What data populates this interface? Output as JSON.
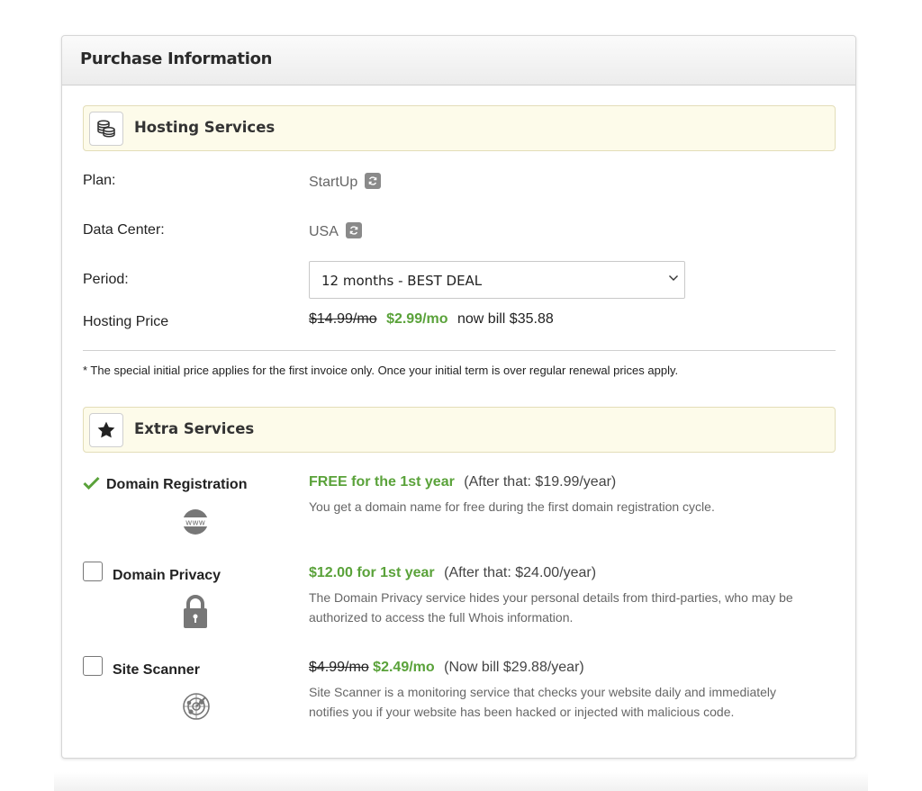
{
  "panel": {
    "title": "Purchase Information"
  },
  "hosting": {
    "section_title": "Hosting Services",
    "section_icon": "coins-icon",
    "plan_label": "Plan:",
    "plan_value": "StartUp",
    "datacenter_label": "Data Center:",
    "datacenter_value": "USA",
    "period_label": "Period:",
    "period_selected": "12 months - BEST DEAL",
    "price_label": "Hosting Price",
    "price_old": "$14.99/mo",
    "price_new": "$2.99/mo",
    "price_bill": "now bill $35.88",
    "note": "* The special initial price applies for the first invoice only. Once your initial term is over regular renewal prices apply."
  },
  "extras": {
    "section_title": "Extra Services",
    "section_icon": "star-icon",
    "items": [
      {
        "name": "Domain Registration",
        "selected": true,
        "icon": "www-globe-icon",
        "price_highlight": "FREE for the 1st year",
        "price_after": "(After that: $19.99/year)",
        "description": "You get a domain name for free during the first domain registration cycle."
      },
      {
        "name": "Domain Privacy",
        "selected": false,
        "icon": "lock-icon",
        "price_highlight": "$12.00 for 1st year",
        "price_after": "(After that: $24.00/year)",
        "description": "The Domain Privacy service hides your personal details from third-parties, who may be authorized to access the full Whois information."
      },
      {
        "name": "Site Scanner",
        "selected": false,
        "icon": "radar-icon",
        "price_old": "$4.99/mo",
        "price_highlight": "$2.49/mo",
        "price_after": "(Now bill $29.88/year)",
        "description": "Site Scanner is a monitoring service that checks your website daily and immediately notifies you if your website has been hacked or injected with malicious code."
      }
    ]
  },
  "colors": {
    "accent_green": "#5aa23a",
    "section_bg": "#fdfbea"
  }
}
